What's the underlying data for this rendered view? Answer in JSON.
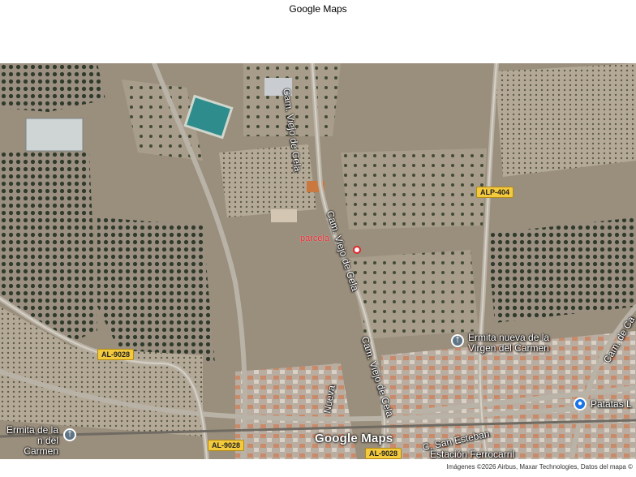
{
  "title": "Google Maps",
  "map": {
    "marker_label": "parcela",
    "streets": [
      {
        "id": "cam-viejo-1",
        "label": "Cam. Viejo de Cela"
      },
      {
        "id": "cam-viejo-2",
        "label": "Cam. Viejo de Cela"
      },
      {
        "id": "cam-viejo-3",
        "label": "Cam. Viejo de Cela"
      },
      {
        "id": "cam-cala",
        "label": "Cam. de Ca"
      },
      {
        "id": "san-esteban",
        "label": "C. San Esteban"
      },
      {
        "id": "nueva",
        "label": "Nueva"
      }
    ],
    "road_shields": [
      {
        "id": "alp-404",
        "label": "ALP-404"
      },
      {
        "id": "al-9028-a",
        "label": "AL-9028"
      },
      {
        "id": "al-9028-b",
        "label": "AL-9028"
      },
      {
        "id": "al-9028-c",
        "label": "AL-9028"
      }
    ],
    "pois": [
      {
        "id": "ermita-nueva",
        "line1": "Ermita nueva de la",
        "line2": "Virgen del Carmen",
        "icon": "church-icon"
      },
      {
        "id": "ermita-carmen",
        "line1": "Ermita de la",
        "line2": "n del Carmen",
        "icon": "church-icon"
      },
      {
        "id": "patatas",
        "line1": "Patatas L",
        "line2": "",
        "icon": "shopping-bag-icon"
      },
      {
        "id": "estacion",
        "line1": "Estación Ferrocarril",
        "line2": "",
        "icon": ""
      }
    ],
    "logo": "Google Maps",
    "attribution": "Imágenes ©2026 Airbus, Maxar Technologies, Datos del mapa ©"
  }
}
